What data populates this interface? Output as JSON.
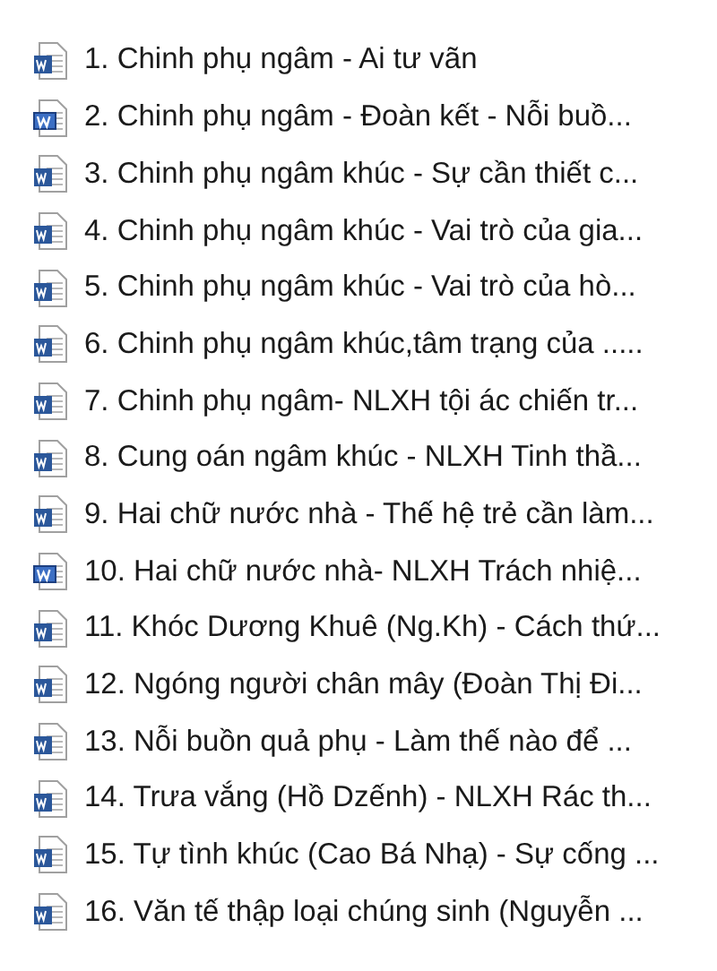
{
  "files": [
    {
      "name": "1. Chinh phụ ngâm - Ai tư vãn",
      "kind": "docx"
    },
    {
      "name": "2. Chinh phụ ngâm - Đoàn kết - Nỗi buồ...",
      "kind": "doc"
    },
    {
      "name": "3. Chinh phụ ngâm khúc - Sự cần thiết c...",
      "kind": "docx"
    },
    {
      "name": "4. Chinh phụ ngâm khúc - Vai trò của gia...",
      "kind": "docx"
    },
    {
      "name": "5. Chinh phụ ngâm khúc - Vai trò của hò...",
      "kind": "docx"
    },
    {
      "name": "6. Chinh phụ ngâm khúc,tâm trạng của .....",
      "kind": "docx"
    },
    {
      "name": "7. Chinh phụ ngâm- NLXH tội ác chiến tr...",
      "kind": "docx"
    },
    {
      "name": "8. Cung oán ngâm khúc - NLXH Tinh thầ...",
      "kind": "docx"
    },
    {
      "name": "9. Hai chữ nước nhà - Thế hệ trẻ cần làm...",
      "kind": "docx"
    },
    {
      "name": "10. Hai chữ nước nhà- NLXH Trách nhiệ...",
      "kind": "doc"
    },
    {
      "name": "11. Khóc Dương Khuê (Ng.Kh) - Cách thứ...",
      "kind": "docx"
    },
    {
      "name": "12. Ngóng người chân mây (Đoàn Thị Đi...",
      "kind": "docx"
    },
    {
      "name": "13. Nỗi buồn quả phụ - Làm thế nào để ...",
      "kind": "docx"
    },
    {
      "name": "14. Trưa vắng (Hồ Dzếnh) - NLXH Rác th...",
      "kind": "docx"
    },
    {
      "name": "15. Tự tình khúc (Cao Bá Nhạ) - Sự cống ...",
      "kind": "docx"
    },
    {
      "name": "16. Văn tế thập loại chúng sinh (Nguyễn ...",
      "kind": "docx"
    }
  ]
}
